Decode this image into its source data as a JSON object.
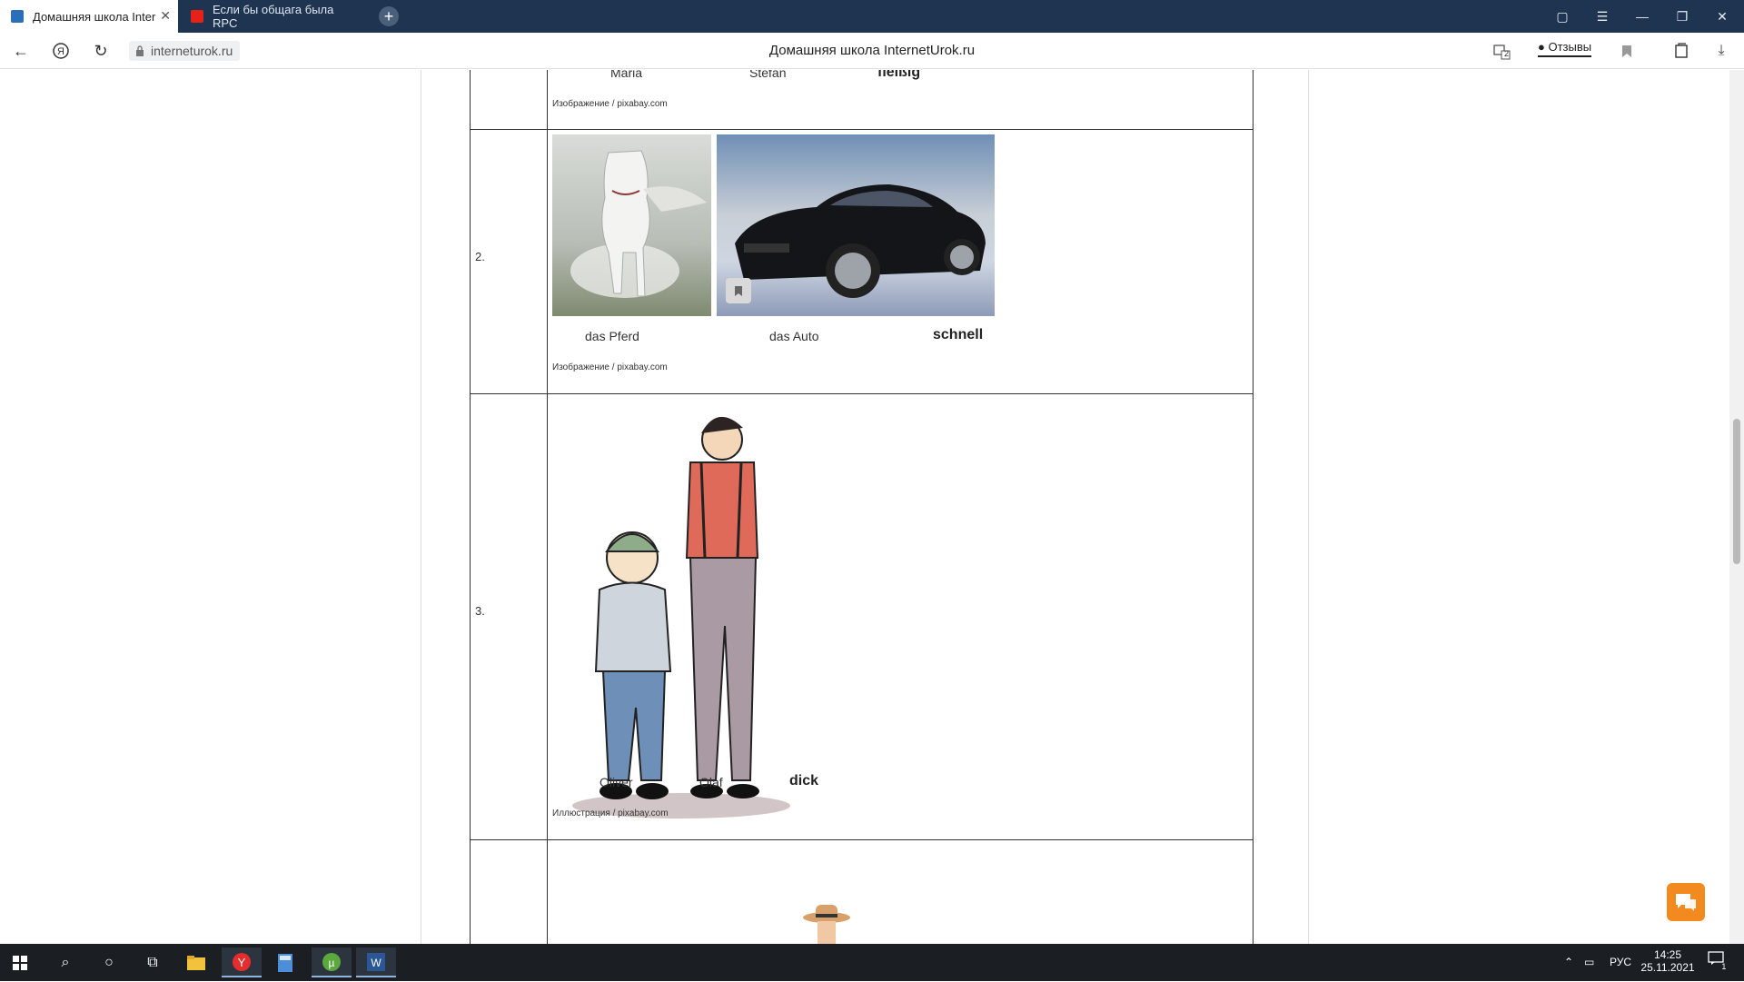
{
  "browser": {
    "tabs": [
      {
        "title": "Домашняя школа Inter",
        "active": true
      },
      {
        "title": "Если бы общага была RPC",
        "active": false
      }
    ],
    "new_tab": "+",
    "address": {
      "url": "interneturok.ru",
      "page_title": "Домашняя школа InternetUrok.ru"
    },
    "reviews_label": "Отзывы",
    "tab_count_badge": "2"
  },
  "content": {
    "row1": {
      "captions": [
        "Maria",
        "Stefan"
      ],
      "adjective": "fleißig",
      "source": "Изображение / pixabay.com"
    },
    "row2": {
      "number": "2.",
      "captions": [
        "das Pferd",
        "das Auto"
      ],
      "adjective": "schnell",
      "source": "Изображение / pixabay.com"
    },
    "row3": {
      "number": "3.",
      "captions": [
        "Oliver",
        "Olaf"
      ],
      "adjective": "dick",
      "source": "Иллюстрация / pixabay.com"
    }
  },
  "taskbar": {
    "language": "РУС",
    "time": "14:25",
    "date": "25.11.2021",
    "notification_count": "1"
  },
  "colors": {
    "tabbar": "#1f3450",
    "taskbar": "#1b1f24",
    "chat_accent": "#f28a1f"
  }
}
